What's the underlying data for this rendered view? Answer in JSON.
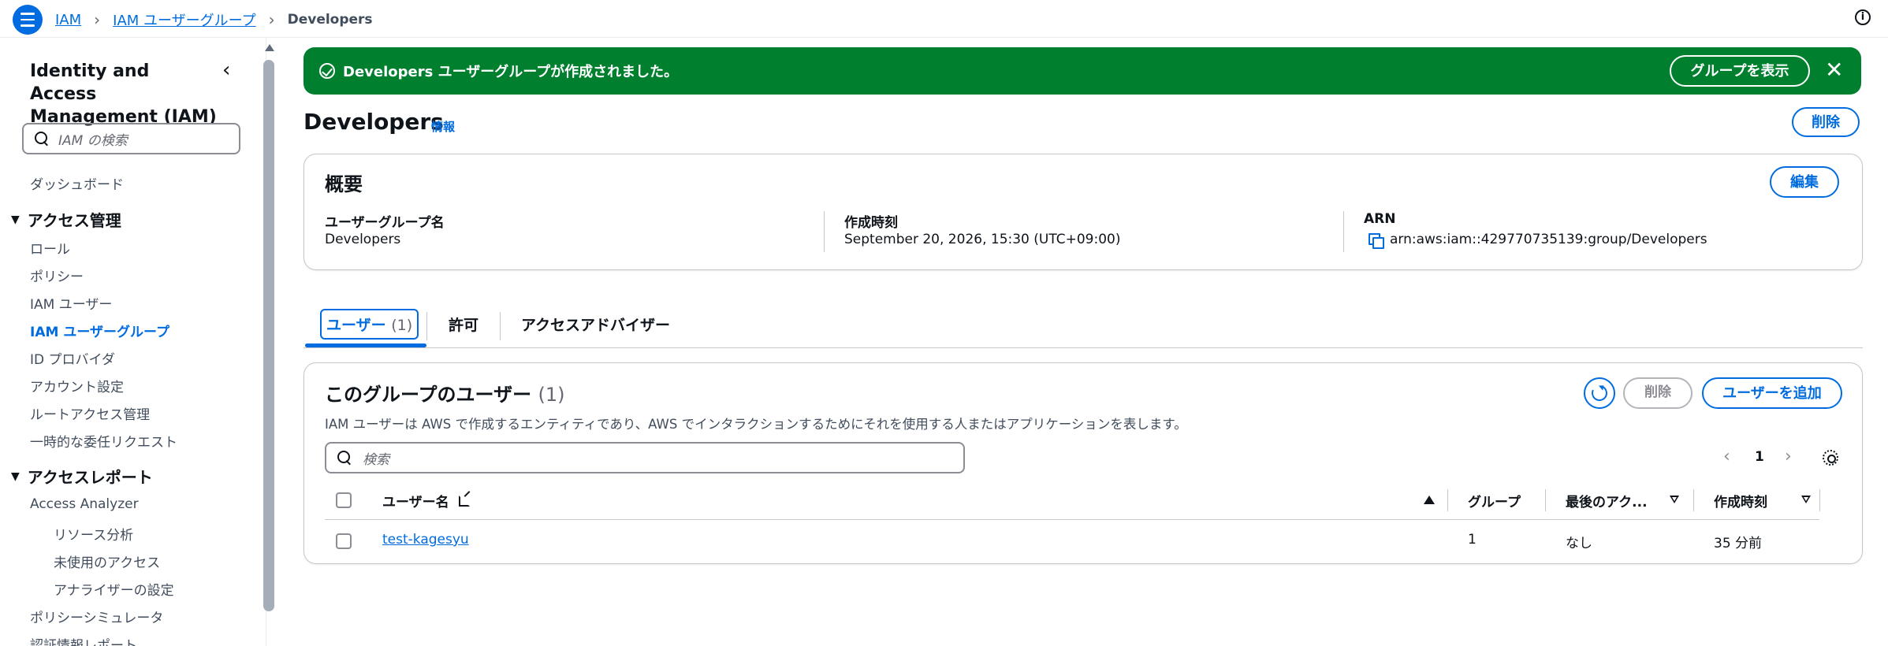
{
  "breadcrumb": {
    "items": [
      "IAM",
      "IAM ユーザーグループ",
      "Developers"
    ]
  },
  "sidebar": {
    "title": "Identity and Access Management (IAM)",
    "search_placeholder": "IAM の検索",
    "items": [
      {
        "label": "ダッシュボード"
      },
      {
        "section": "アクセス管理"
      },
      {
        "label": "ロール"
      },
      {
        "label": "ポリシー"
      },
      {
        "label": "IAM ユーザー"
      },
      {
        "label": "IAM ユーザーグループ",
        "active": true
      },
      {
        "label": "ID プロバイダ"
      },
      {
        "label": "アカウント設定"
      },
      {
        "label": "ルートアクセス管理"
      },
      {
        "label": "一時的な委任リクエスト"
      },
      {
        "section": "アクセスレポート"
      },
      {
        "label": "Access Analyzer"
      },
      {
        "label": "リソース分析"
      },
      {
        "label": "未使用のアクセス"
      },
      {
        "label": "アナライザーの設定"
      },
      {
        "label": "ポリシーシミュレータ"
      },
      {
        "label": "認証情報レポート"
      }
    ]
  },
  "flash": {
    "message": "Developers ユーザーグループが作成されました。",
    "button": "グループを表示",
    "close": "✕"
  },
  "page": {
    "title": "Developers",
    "info": "情報",
    "delete_button": "削除"
  },
  "summary": {
    "heading": "概要",
    "edit_button": "編集",
    "fields": [
      {
        "label": "ユーザーグループ名",
        "value": "Developers"
      },
      {
        "label": "作成時刻",
        "value": "September 20, 2026, 15:30 (UTC+09:00)"
      },
      {
        "label": "ARN",
        "value": "arn:aws:iam::429770735139:group/Developers"
      }
    ]
  },
  "tabs": [
    {
      "label": "ユーザー",
      "count": "(1)",
      "active": true
    },
    {
      "label": "許可"
    },
    {
      "label": "アクセスアドバイザー"
    }
  ],
  "users_panel": {
    "heading": "このグループのユーザー",
    "count": "(1)",
    "description": "IAM ユーザーは AWS で作成するエンティティであり、AWS でインタラクションするためにそれを使用する人またはアプリケーションを表します。",
    "delete_button": "削除",
    "add_button": "ユーザーを追加",
    "search_placeholder": "検索",
    "page": "1",
    "pager_prev": "‹",
    "pager_next": "›",
    "columns": [
      "ユーザー名",
      "グループ",
      "最後のアク...",
      "作成時刻"
    ],
    "rows": [
      {
        "name": "test-kagesyu",
        "groups": "1",
        "last_activity": "なし",
        "created": "35 分前"
      }
    ]
  }
}
